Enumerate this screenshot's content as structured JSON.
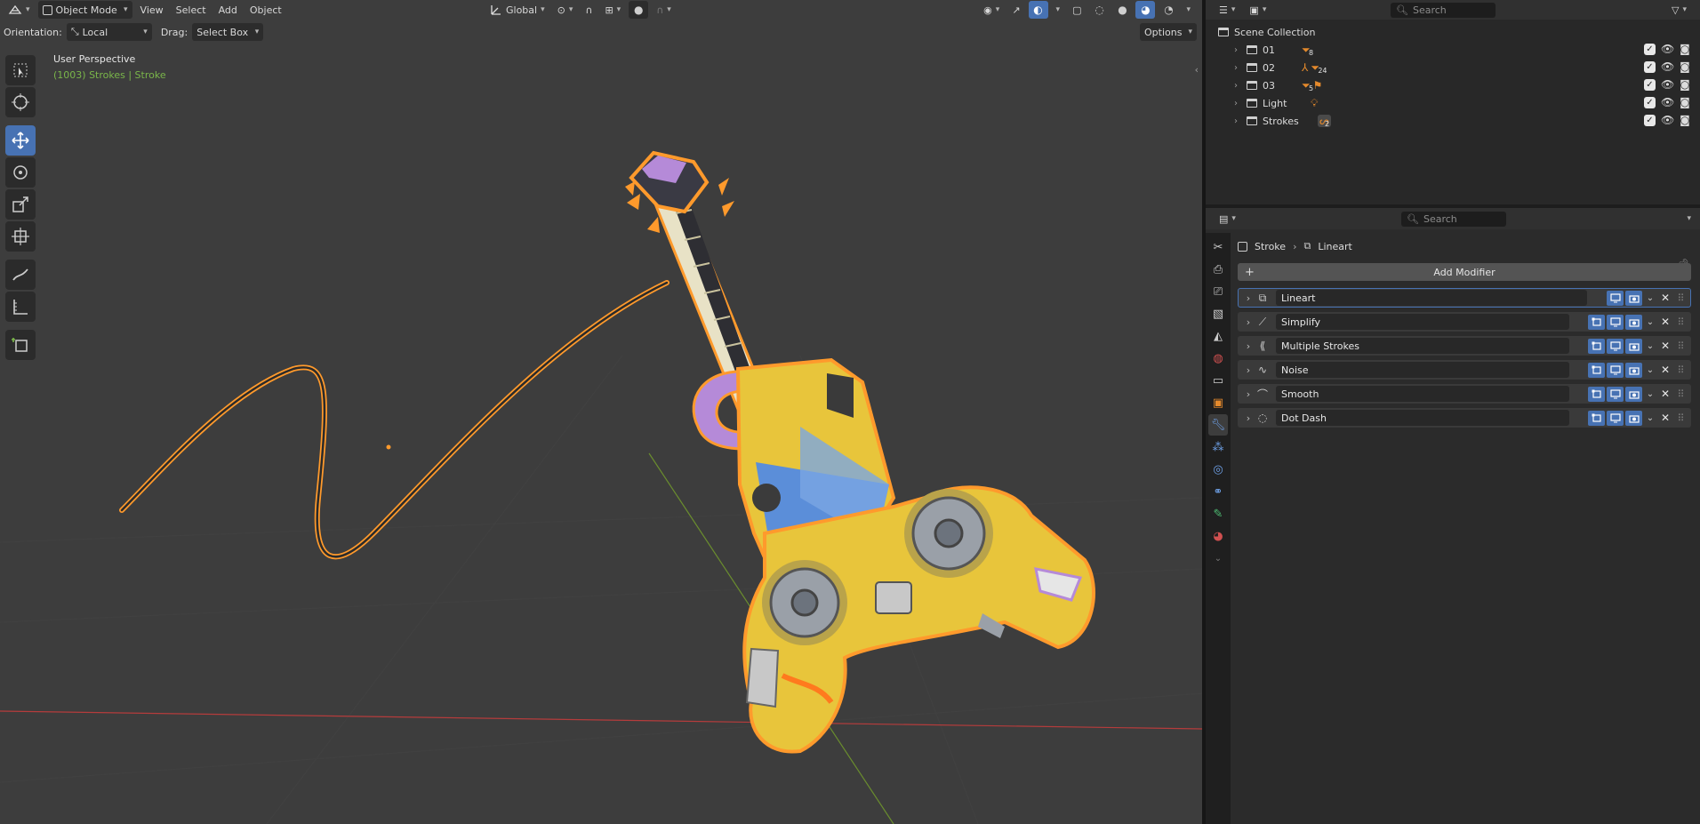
{
  "viewport": {
    "header": {
      "editor_icon": "3d-viewport-icon",
      "mode": "Object Mode",
      "menus": [
        "View",
        "Select",
        "Add",
        "Object"
      ],
      "transform_space": "Global"
    },
    "header2": {
      "orientation_label": "Orientation:",
      "orientation_value": "Local",
      "drag_label": "Drag:",
      "drag_value": "Select Box",
      "options_label": "Options"
    },
    "overlay": {
      "perspective": "User Perspective",
      "selection": "(1003) Strokes | Stroke"
    },
    "tools": [
      "select-box",
      "cursor",
      "move",
      "rotate",
      "scale",
      "transform",
      "annotate",
      "measure",
      "add-cube"
    ],
    "active_tool": "move"
  },
  "outliner": {
    "search_placeholder": "Search",
    "root": "Scene Collection",
    "items": [
      {
        "name": "01",
        "tag_count": "8"
      },
      {
        "name": "02",
        "tag_count": "24"
      },
      {
        "name": "03",
        "tag_count": "5"
      },
      {
        "name": "Light",
        "tag_count": ""
      },
      {
        "name": "Strokes",
        "tag_count": "2"
      }
    ]
  },
  "properties": {
    "search_placeholder": "Search",
    "breadcrumb": {
      "object": "Stroke",
      "data": "Lineart"
    },
    "add_modifier_label": "Add Modifier",
    "modifiers": [
      {
        "name": "Lineart",
        "active": true
      },
      {
        "name": "Simplify",
        "active": false
      },
      {
        "name": "Multiple Strokes",
        "active": false
      },
      {
        "name": "Noise",
        "active": false
      },
      {
        "name": "Smooth",
        "active": false
      },
      {
        "name": "Dot Dash",
        "active": false
      }
    ],
    "tabs": [
      "tool",
      "render",
      "output",
      "view-layer",
      "scene",
      "world",
      "collection",
      "object",
      "modifiers",
      "particles",
      "physics",
      "constraints",
      "data",
      "material"
    ]
  },
  "colors": {
    "accent": "#4772b3",
    "selection_outline": "#ff9a2c",
    "active_text": "#7ab64a",
    "x_axis": "#b53c3c",
    "y_axis": "#6a8d2e"
  }
}
